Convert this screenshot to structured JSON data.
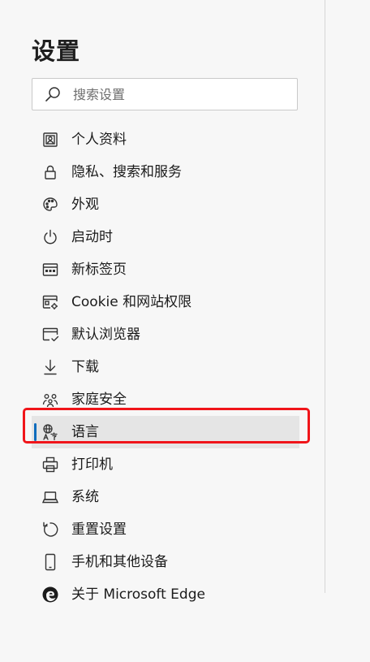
{
  "settings": {
    "title": "设置",
    "search_placeholder": "搜索设置"
  },
  "nav": {
    "items": [
      {
        "label": "个人资料",
        "icon": "profile-icon"
      },
      {
        "label": "隐私、搜索和服务",
        "icon": "lock-icon"
      },
      {
        "label": "外观",
        "icon": "palette-icon"
      },
      {
        "label": "启动时",
        "icon": "power-icon"
      },
      {
        "label": "新标签页",
        "icon": "new-tab-icon"
      },
      {
        "label": "Cookie 和网站权限",
        "icon": "site-permissions-icon"
      },
      {
        "label": "默认浏览器",
        "icon": "default-browser-icon"
      },
      {
        "label": "下载",
        "icon": "download-icon"
      },
      {
        "label": "家庭安全",
        "icon": "family-icon"
      },
      {
        "label": "语言",
        "icon": "language-icon",
        "active": true
      },
      {
        "label": "打印机",
        "icon": "printer-icon"
      },
      {
        "label": "系统",
        "icon": "laptop-icon"
      },
      {
        "label": "重置设置",
        "icon": "reset-icon"
      },
      {
        "label": "手机和其他设备",
        "icon": "phone-icon"
      },
      {
        "label": "关于 Microsoft Edge",
        "icon": "edge-logo-icon"
      }
    ]
  },
  "colors": {
    "accent": "#0f6cbd",
    "highlight_border": "#f0151a",
    "active_bg": "#e5e5e5"
  }
}
